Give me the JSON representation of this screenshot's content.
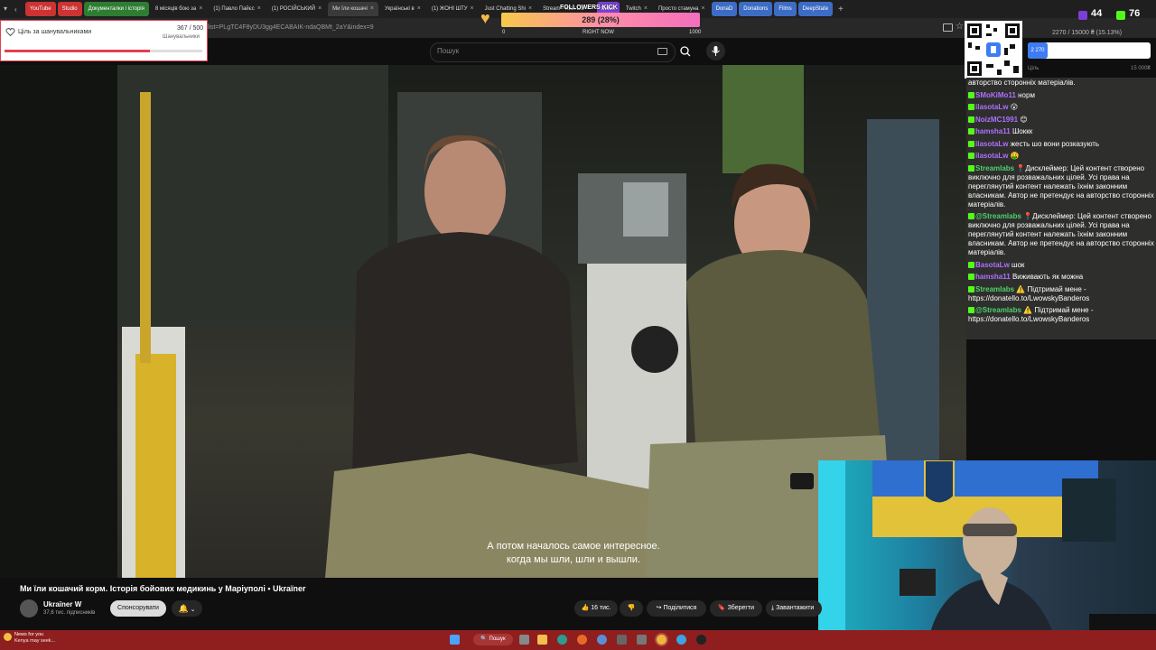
{
  "browser": {
    "tabs": [
      {
        "label": "YouTube",
        "pill": "#c33"
      },
      {
        "label": "Studio",
        "pill": "#c33"
      },
      {
        "label": "Документалки і історія",
        "pill": "#2e7d32"
      },
      {
        "label": "8 місяців бою за"
      },
      {
        "label": "(1) Павло Пайєс"
      },
      {
        "label": "(1) РОСІЙСЬКИЙ"
      },
      {
        "label": "Ми їли кошачі",
        "active": true
      },
      {
        "label": "Українські в"
      },
      {
        "label": "(1) ЖОНІ ШТУ"
      },
      {
        "label": "Just Chatting Shi"
      },
      {
        "label": "Stream - Kick Da"
      },
      {
        "label": "twitch",
        "pill": "#7b3fd8"
      },
      {
        "label": "Twitch"
      },
      {
        "label": "Просто стамуна"
      },
      {
        "label": "DonaD",
        "pill": "#3d6cc5"
      },
      {
        "label": "Donations",
        "pill": "#3d6cc5"
      },
      {
        "label": "Films",
        "pill": "#3d6cc5"
      },
      {
        "label": "DeepState",
        "pill": "#3d6cc5"
      }
    ],
    "url": "list=PLgTC4F8yDU3gg4ECABAIK-ndaQBMt_2aY&index=9"
  },
  "youtube": {
    "search_placeholder": "Пошук",
    "video_title": "Ми їли кошачий корм. Історія бойових медикинь у Маріуполі • Ukraїner",
    "channel_name": "Ukraїner W",
    "channel_subs": "37,6 тис. підписників",
    "sponsor_label": "Спонсорувати",
    "like_count": "16 тис.",
    "share_label": "Поділитися",
    "save_label": "Зберегти",
    "download_label": "Завантажити",
    "subtitle_line1": "А потом началось самое интересное.",
    "subtitle_line2": "когда мы шли, шли и вышли."
  },
  "overlay": {
    "follower_goal": {
      "title": "Ціль за шанувальниками",
      "count": "367 / 500",
      "sublabel": "Шанувальники",
      "progress": 0.734
    },
    "top_bar": {
      "label": "FOLLOWERS KICK",
      "value": "289 (28%)",
      "min": "0",
      "mid": "RIGHT NOW",
      "max": "1000",
      "progress": 0.28
    },
    "donation": {
      "text": "2270 / 15000 ₴ (15.13%)",
      "badge": "2 270",
      "start_label": "Ціль",
      "end_label": "15 000₴"
    },
    "viewers_twitch": "44",
    "viewers_kick": "76"
  },
  "chat": [
    {
      "user": "",
      "text": "авторство сторонніх матеріалів.",
      "color": "#ffffff"
    },
    {
      "user": "SMoKiMo11",
      "text": "норм",
      "color": "#b06fff"
    },
    {
      "user": "ilasotaLw",
      "text": "😮",
      "color": "#b06fff"
    },
    {
      "user": "NoizMC1991",
      "text": "😊",
      "color": "#b06fff"
    },
    {
      "user": "hamsha11",
      "text": "Шоккк",
      "color": "#b06fff"
    },
    {
      "user": "ilasotaLw",
      "text": "жесть шо вони розказують",
      "color": "#b06fff"
    },
    {
      "user": "ilasotaLw",
      "text": "🤑",
      "color": "#b06fff"
    },
    {
      "user": "Streamlabs",
      "text": "📍Дисклеймер: Цей контент створено виключно для розважальних цілей. Усі права на переглянутий контент належать їхнім законним власникам. Автор не претендує на авторство сторонніх матеріалів.",
      "color": "#4fd16c"
    },
    {
      "user": "@Streamlabs",
      "text": "📍Дисклеймер: Цей контент створено виключно для розважальних цілей. Усі права на переглянутий контент належать їхнім законним власникам. Автор не претендує на авторство сторонніх матеріалів.",
      "color": "#4fd16c"
    },
    {
      "user": "BasotaLw",
      "text": "шок",
      "color": "#b06fff"
    },
    {
      "user": "hamsha11",
      "text": "Виживають як можна",
      "color": "#b06fff"
    },
    {
      "user": "Streamlabs",
      "text": "⚠️ Підтримай мене - https://donatello.to/LwowskyBanderos",
      "color": "#4fd16c"
    },
    {
      "user": "@Streamlabs",
      "text": "⚠️ Підтримай мене - https://donatello.to/LwowskyBanderos",
      "color": "#4fd16c"
    }
  ],
  "taskbar": {
    "news_title": "News for you",
    "news_sub": "Kenya may seek...",
    "search_label": "Пошук"
  }
}
